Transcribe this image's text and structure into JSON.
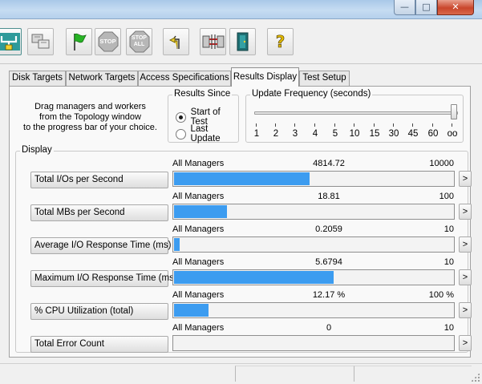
{
  "window": {
    "minimize_glyph": "—",
    "maximize_glyph": "□",
    "close_glyph": "✕"
  },
  "toolbar": {
    "buttons": [
      {
        "name": "topology-icon",
        "label": ""
      },
      {
        "name": "copy-manager-icon",
        "label": ""
      },
      {
        "name": "start-flag-icon",
        "label": ""
      },
      {
        "name": "stop-icon",
        "label": "STOP"
      },
      {
        "name": "stop-all-icon",
        "label": "STOP ALL"
      },
      {
        "name": "reset-workers-icon",
        "label": ""
      },
      {
        "name": "disconnect-icon",
        "label": ""
      },
      {
        "name": "exit-door-icon",
        "label": ""
      },
      {
        "name": "help-icon",
        "label": "?"
      }
    ]
  },
  "tabs": [
    {
      "label": "Disk Targets",
      "active": false
    },
    {
      "label": "Network Targets",
      "active": false
    },
    {
      "label": "Access Specifications",
      "active": false
    },
    {
      "label": "Results Display",
      "active": true
    },
    {
      "label": "Test Setup",
      "active": false
    }
  ],
  "drag_note": [
    "Drag managers and workers",
    "from the Topology window",
    "to the progress bar of your choice."
  ],
  "results_since": {
    "legend": "Results Since",
    "options": [
      {
        "label": "Start of Test",
        "selected": true
      },
      {
        "label": "Last Update",
        "selected": false
      }
    ]
  },
  "update_frequency": {
    "legend": "Update Frequency (seconds)",
    "labels": [
      "1",
      "2",
      "3",
      "4",
      "5",
      "10",
      "15",
      "30",
      "45",
      "60",
      "oo"
    ],
    "selected": "oo"
  },
  "display": {
    "legend": "Display",
    "rows": [
      {
        "label": "Total I/Os per Second",
        "scope": "All Managers",
        "value": "4814.72",
        "max": "10000",
        "fraction": 0.4815,
        "arrow": ">"
      },
      {
        "label": "Total MBs per Second",
        "scope": "All Managers",
        "value": "18.81",
        "max": "100",
        "fraction": 0.1881,
        "arrow": ">"
      },
      {
        "label": "Average I/O Response Time (ms)",
        "scope": "All Managers",
        "value": "0.2059",
        "max": "10",
        "fraction": 0.0206,
        "arrow": ">"
      },
      {
        "label": "Maximum I/O Response Time (ms)",
        "scope": "All Managers",
        "value": "5.6794",
        "max": "10",
        "fraction": 0.5679,
        "arrow": ">"
      },
      {
        "label": "% CPU Utilization (total)",
        "scope": "All Managers",
        "value": "12.17 %",
        "max": "100 %",
        "fraction": 0.1217,
        "arrow": ">"
      },
      {
        "label": "Total Error Count",
        "scope": "All Managers",
        "value": "0",
        "max": "10",
        "fraction": 0.0,
        "arrow": ">"
      }
    ]
  },
  "colors": {
    "bar_fill": "#3c9cf0"
  }
}
